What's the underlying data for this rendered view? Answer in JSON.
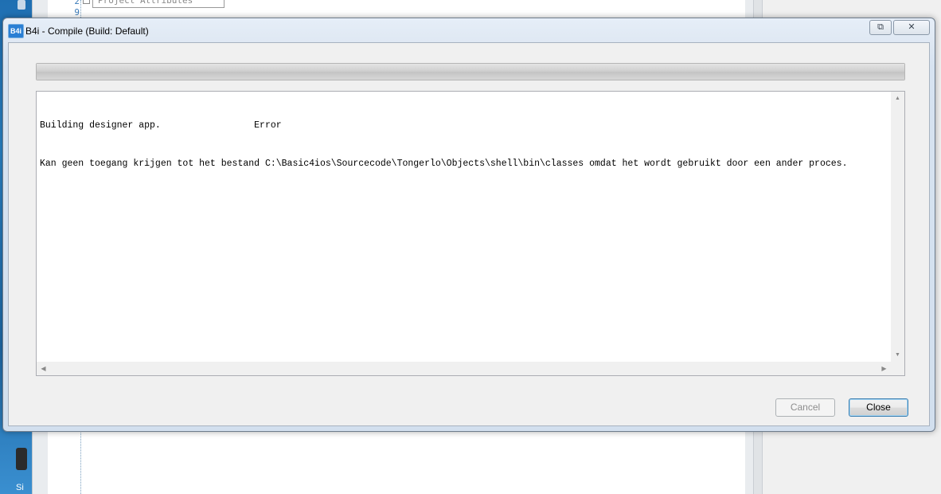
{
  "background": {
    "line_numbers": [
      "2",
      "9"
    ],
    "region_label": "Project Attributes",
    "taskbar_text": "Si"
  },
  "dialog": {
    "app_icon_label": "B4i",
    "title": "B4i - Compile (Build: Default)",
    "restore_glyph": "⧉",
    "close_glyph": "✕",
    "progress_percent": 100,
    "log_lines": [
      "Building designer app.                 Error",
      "Kan geen toegang krijgen tot het bestand C:\\Basic4ios\\Sourcecode\\Tongerlo\\Objects\\shell\\bin\\classes omdat het wordt gebruikt door een ander proces."
    ],
    "buttons": {
      "cancel_label": "Cancel",
      "close_label": "Close"
    },
    "scroll_glyphs": {
      "up": "▲",
      "down": "▼",
      "left": "◀",
      "right": "▶"
    }
  }
}
